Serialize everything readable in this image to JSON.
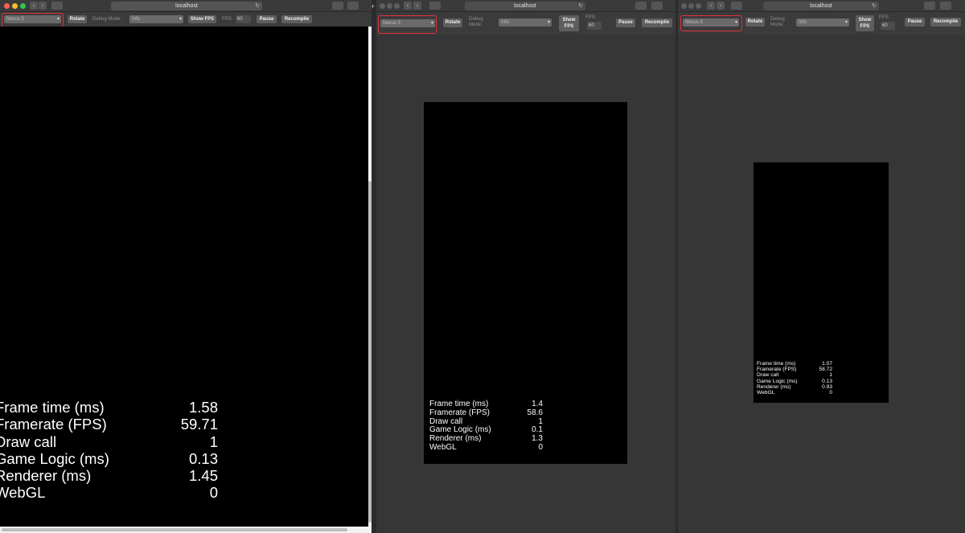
{
  "toolbar": {
    "rotate_label": "Rotate",
    "debug_mode_label": "Debug Mode:",
    "debug_mode_value": "Info",
    "show_fps_label": "Show FPS",
    "fps_label": "FPS:",
    "fps_value": "60",
    "pause_label": "Pause",
    "recompile_label": "Recompile",
    "device_select_value": "Nexus 5"
  },
  "browser": {
    "url": "localhost"
  },
  "windows": [
    {
      "name": "left",
      "stats": [
        {
          "label": "Frame time (ms)",
          "value": "1.58"
        },
        {
          "label": "Framerate (FPS)",
          "value": "59.71"
        },
        {
          "label": "Draw call",
          "value": "1"
        },
        {
          "label": "Game Logic (ms)",
          "value": "0.13"
        },
        {
          "label": "Renderer (ms)",
          "value": "1.45"
        },
        {
          "label": "WebGL",
          "value": "0"
        }
      ]
    },
    {
      "name": "middle",
      "stats": [
        {
          "label": "Frame time (ms)",
          "value": "1.4"
        },
        {
          "label": "Framerate (FPS)",
          "value": "58.6"
        },
        {
          "label": "Draw call",
          "value": "1"
        },
        {
          "label": "Game Logic (ms)",
          "value": "0.1"
        },
        {
          "label": "Renderer (ms)",
          "value": "1.3"
        },
        {
          "label": "WebGL",
          "value": "0"
        }
      ]
    },
    {
      "name": "right",
      "stats": [
        {
          "label": "Frame time (ms)",
          "value": "1.07"
        },
        {
          "label": "Framerate (FPS)",
          "value": "58.72"
        },
        {
          "label": "Draw call",
          "value": "1"
        },
        {
          "label": "Game Logic (ms)",
          "value": "0.13"
        },
        {
          "label": "Renderer (ms)",
          "value": "0.93"
        },
        {
          "label": "WebGL",
          "value": "0"
        }
      ]
    }
  ],
  "colors": {
    "highlight": "#e0323c",
    "close": "#fc5f57",
    "minimize": "#fdbc2e",
    "maximize": "#33c748"
  }
}
